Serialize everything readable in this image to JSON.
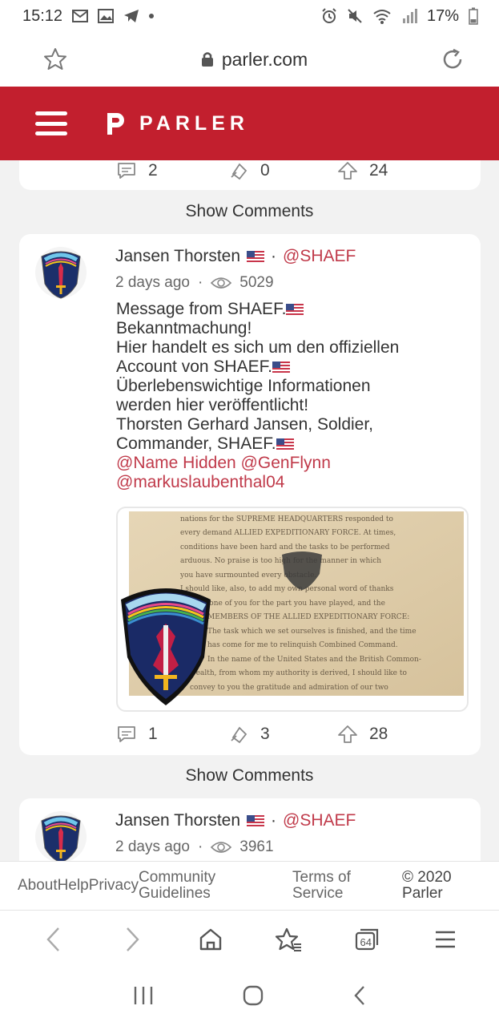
{
  "status_bar": {
    "time": "15:12",
    "left_icons": [
      "gmail-icon",
      "gallery-icon",
      "telegram-icon",
      "dot-icon"
    ],
    "right_icons": [
      "alarm-icon",
      "mute-icon",
      "wifi-icon",
      "signal-icon"
    ],
    "battery": "17%"
  },
  "url_bar": {
    "domain": "parler.com"
  },
  "header": {
    "brand": "PARLER"
  },
  "feed": {
    "top_card": {
      "comments": "2",
      "echoes": "0",
      "upvotes": "24"
    },
    "show_comments_label": "Show Comments",
    "posts": [
      {
        "name": "Jansen Thorsten",
        "handle": "@SHAEF",
        "time": "2 days ago",
        "views": "5029",
        "body_lines": [
          "Message from SHAEF.",
          "Bekanntmachung!",
          "Hier handelt es sich um den offiziellen",
          "Account von SHAEF.",
          "Überlebenswichtige Informationen",
          "werden hier veröffentlicht!",
          "Thorsten Gerhard Jansen, Soldier,",
          "Commander, SHAEF."
        ],
        "mentions_line1": "@Name Hidden @GenFlynn",
        "mentions_line2": "@markuslaubenthal04",
        "image_text": [
          "nations for the SUPREME HEADQUARTERS responded to",
          "every demand ALLIED EXPEDITIONARY FORCE. At times,",
          "conditions have been hard and the tasks to be performed",
          "arduous. No praise is too high for the manner in which",
          "you have surmounted every obstacle.",
          "I should like, also, to add my own personal word of thanks",
          "to each one of you for the part you have played, and the",
          "MEMBERS OF THE ALLIED EXPEDITIONARY FORCE:",
          "The task which we set ourselves is finished, and the time",
          "has come for me to relinquish Combined Command.",
          "In the name of the United States and the British Common-",
          "wealth, from whom my authority is derived, I should like to",
          "convey to you the gratitude and admiration of our two"
        ],
        "comments": "1",
        "echoes": "3",
        "upvotes": "28"
      },
      {
        "name": "Jansen Thorsten",
        "handle": "@SHAEF",
        "time": "2 days ago",
        "views": "3961"
      }
    ]
  },
  "footer": {
    "about": "About",
    "help": "Help",
    "privacy": "Privacy",
    "community_1": "Community",
    "community_2": "Guidelines",
    "terms_1": "Terms of",
    "terms_2": "Service",
    "copyright_1": "© 2020",
    "copyright_2": "Parler"
  },
  "browser_nav": {
    "tabs_count": "64"
  },
  "colors": {
    "brand_red": "#c21f2e",
    "mention": "#c03a4a",
    "feed_bg": "#f2f2f2"
  }
}
